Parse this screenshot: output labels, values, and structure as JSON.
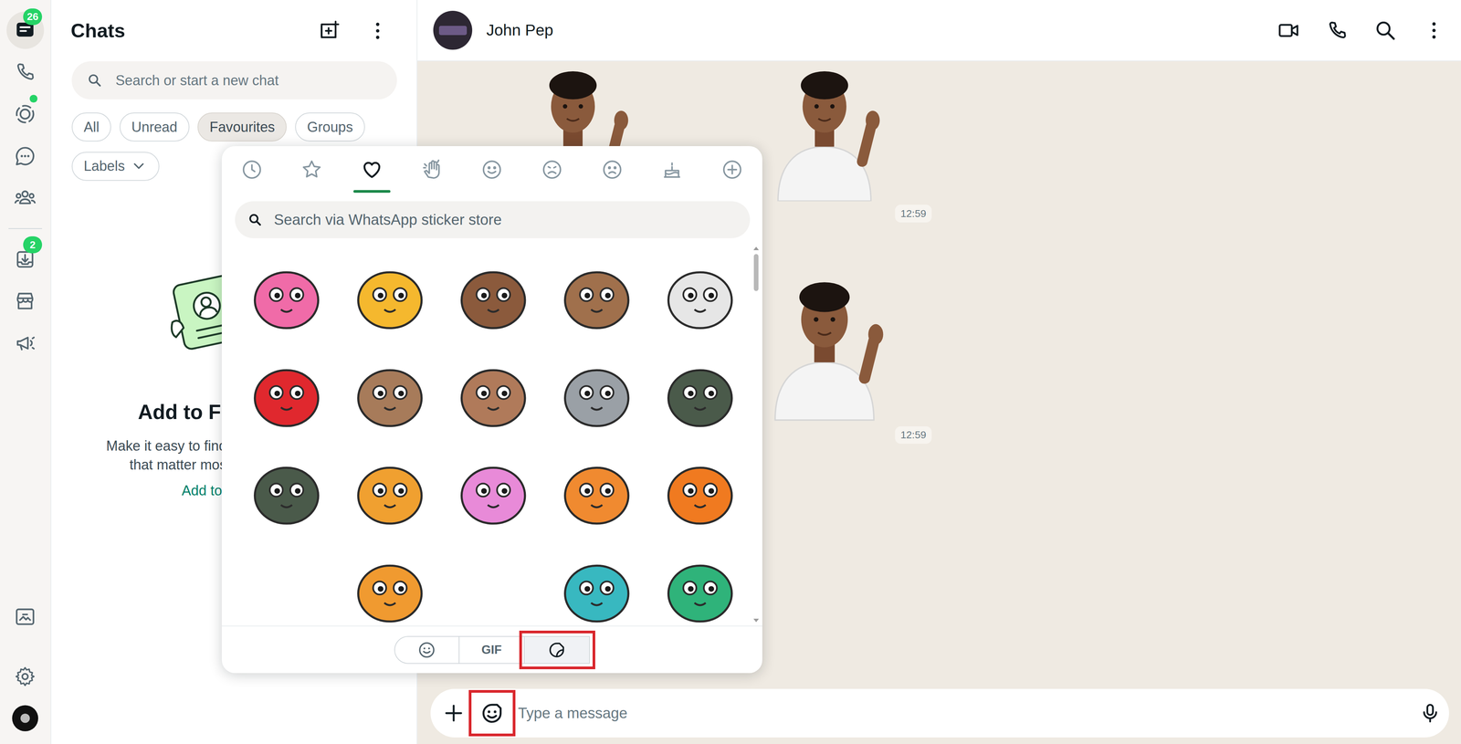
{
  "rail": {
    "top": [
      {
        "kind": "chats",
        "selected": true,
        "badge": "26",
        "dot": false
      },
      {
        "kind": "calls",
        "selected": false,
        "badge": "",
        "dot": false
      },
      {
        "kind": "status",
        "selected": false,
        "badge": "",
        "dot": true
      },
      {
        "kind": "channels",
        "selected": false,
        "badge": "",
        "dot": false
      },
      {
        "kind": "communities",
        "selected": false,
        "badge": "",
        "dot": false
      }
    ],
    "middle": [
      {
        "kind": "archive",
        "selected": false,
        "badge": "2",
        "dot": false
      },
      {
        "kind": "store",
        "selected": false,
        "badge": "",
        "dot": false
      },
      {
        "kind": "broadcast",
        "selected": false,
        "badge": "",
        "dot": false
      }
    ],
    "bottom": [
      {
        "kind": "media",
        "selected": false
      },
      {
        "kind": "settings",
        "selected": false
      },
      {
        "kind": "profile",
        "selected": false
      }
    ]
  },
  "chats_panel": {
    "title": "Chats",
    "search": {
      "placeholder": "Search or start a new chat"
    },
    "filters": [
      {
        "label": "All",
        "selected": false
      },
      {
        "label": "Unread",
        "selected": false
      },
      {
        "label": "Favourites",
        "selected": true
      },
      {
        "label": "Groups",
        "selected": false
      }
    ],
    "labels": "Labels",
    "empty_state": {
      "title": "Add to F",
      "lines": [
        "Make it easy to find",
        "that matter mos"
      ],
      "link": "Add to"
    }
  },
  "chat": {
    "contact": "John Pep",
    "messages": [
      {
        "stickers": 2,
        "time": "12:59"
      },
      {
        "stickers": 1,
        "time": "12:59"
      }
    ],
    "composer": {
      "placeholder": "Type a message",
      "sticker_highlighted": true
    }
  },
  "sticker_panel": {
    "categories": [
      {
        "kind": "recent",
        "selected": false
      },
      {
        "kind": "favourite",
        "selected": false
      },
      {
        "kind": "love",
        "selected": true
      },
      {
        "kind": "greeting",
        "selected": false
      },
      {
        "kind": "happy",
        "selected": false
      },
      {
        "kind": "sad",
        "selected": false
      },
      {
        "kind": "upset",
        "selected": false
      },
      {
        "kind": "celebrate",
        "selected": false
      },
      {
        "kind": "add",
        "selected": false
      }
    ],
    "search": {
      "placeholder": "Search via WhatsApp sticker store"
    },
    "stickers": [
      {
        "color": "#f06ba8",
        "loaded": true
      },
      {
        "color": "#f5b82e",
        "loaded": true
      },
      {
        "color": "#8b5a3c",
        "loaded": true
      },
      {
        "color": "#a0704c",
        "loaded": true
      },
      {
        "color": "#e6e6e6",
        "loaded": true
      },
      {
        "color": "#e0282e",
        "loaded": true
      },
      {
        "color": "#a77b5a",
        "loaded": true
      },
      {
        "color": "#b07a5a",
        "loaded": true
      },
      {
        "color": "#9aa0a6",
        "loaded": true
      },
      {
        "color": "#4a5a4a",
        "loaded": true
      },
      {
        "color": "#4a5a4a",
        "loaded": true
      },
      {
        "color": "#f0a030",
        "loaded": true
      },
      {
        "color": "#e88ad8",
        "loaded": true
      },
      {
        "color": "#f08a30",
        "loaded": true
      },
      {
        "color": "#f07a20",
        "loaded": true
      },
      {
        "color": "#ffffff",
        "loaded": false
      },
      {
        "color": "#f09a30",
        "loaded": true
      },
      {
        "color": "#ffffff",
        "loaded": false
      },
      {
        "color": "#38b8c0",
        "loaded": true
      },
      {
        "color": "#2fb37a",
        "loaded": true
      }
    ],
    "modes": [
      {
        "kind": "emoji",
        "selected": false,
        "highlighted": false
      },
      {
        "kind": "gif",
        "label": "GIF",
        "selected": false,
        "highlighted": false
      },
      {
        "kind": "sticker",
        "selected": true,
        "highlighted": true
      }
    ]
  }
}
